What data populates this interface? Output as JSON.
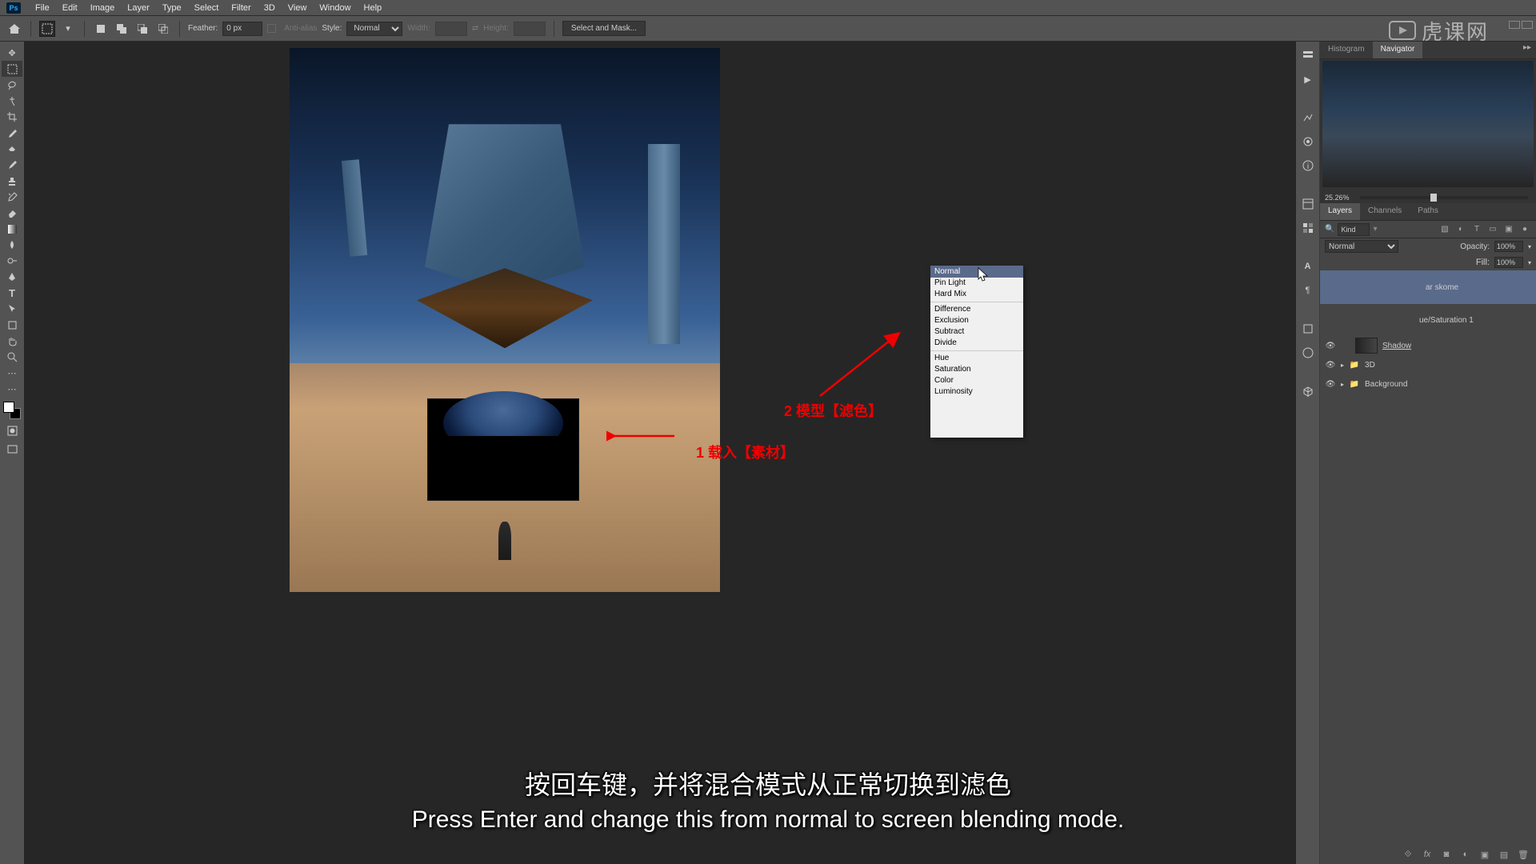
{
  "app": {
    "logo": "Ps"
  },
  "menu": [
    "File",
    "Edit",
    "Image",
    "Layer",
    "Type",
    "Select",
    "Filter",
    "3D",
    "View",
    "Window",
    "Help"
  ],
  "optbar": {
    "feather_label": "Feather:",
    "feather_val": "0 px",
    "aa_label": "Anti-alias",
    "style_label": "Style:",
    "style_val": "Normal",
    "width_label": "Width:",
    "height_label": "Height:",
    "mask_btn": "Select and Mask..."
  },
  "nav": {
    "tabs": {
      "hist": "Histogram",
      "nav": "Navigator"
    },
    "zoom": "25.26%"
  },
  "layers": {
    "tabs": {
      "layers": "Layers",
      "channels": "Channels",
      "paths": "Paths"
    },
    "kind": "Kind",
    "blend": "Normal",
    "opacity_label": "Opacity:",
    "opacity_val": "100%",
    "fill_label": "Fill:",
    "fill_val": "100%",
    "items": {
      "skome": "ar skome",
      "huesat": "ue/Saturation 1",
      "shadow": "Shadow",
      "threeD": "3D",
      "bg": "Background"
    }
  },
  "dropdown": {
    "pinlight": "Pin Light",
    "hardmix": "Hard Mix",
    "difference": "Difference",
    "exclusion": "Exclusion",
    "subtract": "Subtract",
    "divide": "Divide",
    "hue": "Hue",
    "saturation": "Saturation",
    "color": "Color",
    "luminosity": "Luminosity"
  },
  "annotations": {
    "a1": "1 载入【素材】",
    "a2": "2 模型【滤色】"
  },
  "subtitles": {
    "cn": "按回车键，并将混合模式从正常切换到滤色",
    "en": "Press Enter and change this from normal to screen blending mode."
  },
  "watermark": "虎课网"
}
